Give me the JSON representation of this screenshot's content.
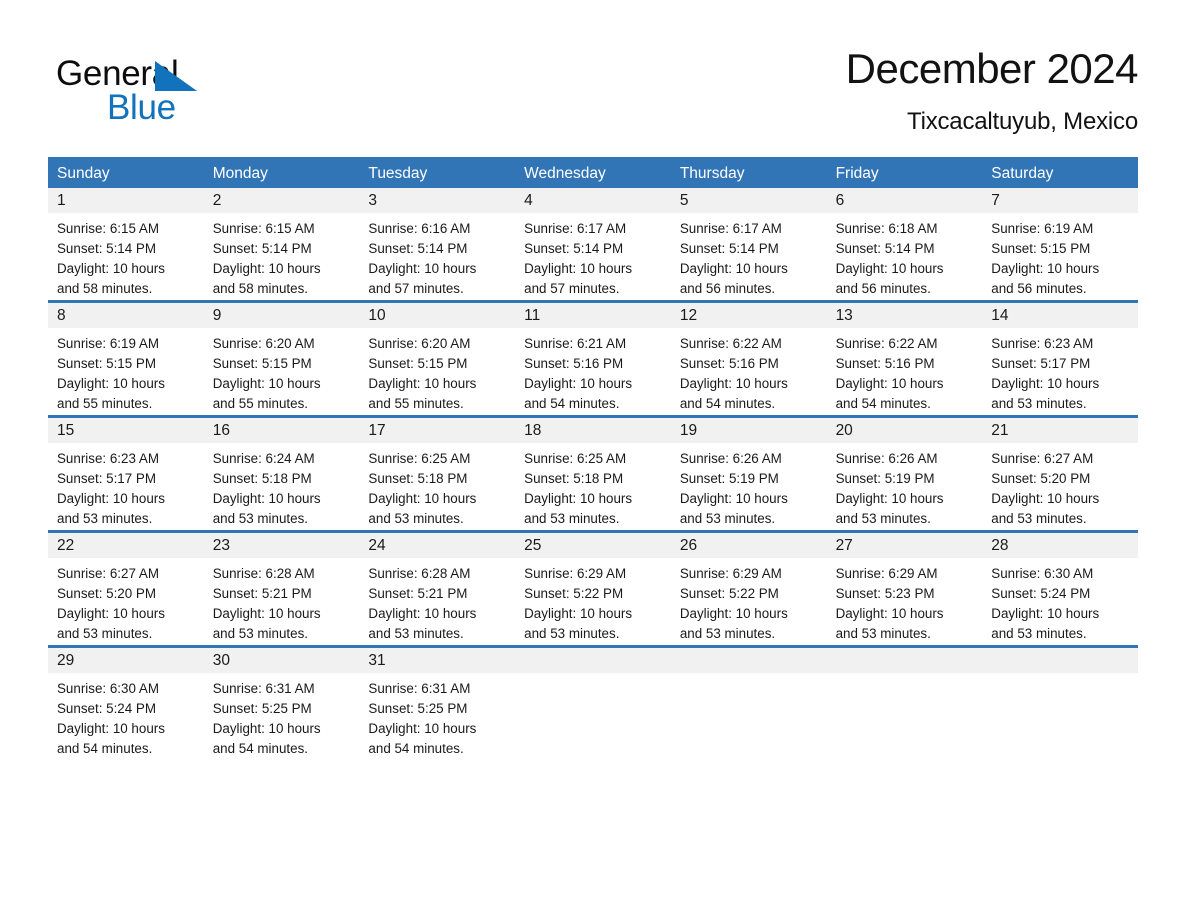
{
  "brand": {
    "name_part1": "General",
    "name_part2": "Blue",
    "triangle_color": "#1272bb",
    "text_color": "#0d0d0d"
  },
  "header": {
    "month_title": "December 2024",
    "location": "Tixcacaltuyub, Mexico"
  },
  "calendar": {
    "header_bg": "#3275b7",
    "header_text_color": "#ffffff",
    "daynum_bg": "#f1f1f1",
    "weekdays": [
      "Sunday",
      "Monday",
      "Tuesday",
      "Wednesday",
      "Thursday",
      "Friday",
      "Saturday"
    ],
    "weeks": [
      [
        {
          "day": "1",
          "sunrise": "Sunrise: 6:15 AM",
          "sunset": "Sunset: 5:14 PM",
          "daylight_line1": "Daylight: 10 hours",
          "daylight_line2": "and 58 minutes."
        },
        {
          "day": "2",
          "sunrise": "Sunrise: 6:15 AM",
          "sunset": "Sunset: 5:14 PM",
          "daylight_line1": "Daylight: 10 hours",
          "daylight_line2": "and 58 minutes."
        },
        {
          "day": "3",
          "sunrise": "Sunrise: 6:16 AM",
          "sunset": "Sunset: 5:14 PM",
          "daylight_line1": "Daylight: 10 hours",
          "daylight_line2": "and 57 minutes."
        },
        {
          "day": "4",
          "sunrise": "Sunrise: 6:17 AM",
          "sunset": "Sunset: 5:14 PM",
          "daylight_line1": "Daylight: 10 hours",
          "daylight_line2": "and 57 minutes."
        },
        {
          "day": "5",
          "sunrise": "Sunrise: 6:17 AM",
          "sunset": "Sunset: 5:14 PM",
          "daylight_line1": "Daylight: 10 hours",
          "daylight_line2": "and 56 minutes."
        },
        {
          "day": "6",
          "sunrise": "Sunrise: 6:18 AM",
          "sunset": "Sunset: 5:14 PM",
          "daylight_line1": "Daylight: 10 hours",
          "daylight_line2": "and 56 minutes."
        },
        {
          "day": "7",
          "sunrise": "Sunrise: 6:19 AM",
          "sunset": "Sunset: 5:15 PM",
          "daylight_line1": "Daylight: 10 hours",
          "daylight_line2": "and 56 minutes."
        }
      ],
      [
        {
          "day": "8",
          "sunrise": "Sunrise: 6:19 AM",
          "sunset": "Sunset: 5:15 PM",
          "daylight_line1": "Daylight: 10 hours",
          "daylight_line2": "and 55 minutes."
        },
        {
          "day": "9",
          "sunrise": "Sunrise: 6:20 AM",
          "sunset": "Sunset: 5:15 PM",
          "daylight_line1": "Daylight: 10 hours",
          "daylight_line2": "and 55 minutes."
        },
        {
          "day": "10",
          "sunrise": "Sunrise: 6:20 AM",
          "sunset": "Sunset: 5:15 PM",
          "daylight_line1": "Daylight: 10 hours",
          "daylight_line2": "and 55 minutes."
        },
        {
          "day": "11",
          "sunrise": "Sunrise: 6:21 AM",
          "sunset": "Sunset: 5:16 PM",
          "daylight_line1": "Daylight: 10 hours",
          "daylight_line2": "and 54 minutes."
        },
        {
          "day": "12",
          "sunrise": "Sunrise: 6:22 AM",
          "sunset": "Sunset: 5:16 PM",
          "daylight_line1": "Daylight: 10 hours",
          "daylight_line2": "and 54 minutes."
        },
        {
          "day": "13",
          "sunrise": "Sunrise: 6:22 AM",
          "sunset": "Sunset: 5:16 PM",
          "daylight_line1": "Daylight: 10 hours",
          "daylight_line2": "and 54 minutes."
        },
        {
          "day": "14",
          "sunrise": "Sunrise: 6:23 AM",
          "sunset": "Sunset: 5:17 PM",
          "daylight_line1": "Daylight: 10 hours",
          "daylight_line2": "and 53 minutes."
        }
      ],
      [
        {
          "day": "15",
          "sunrise": "Sunrise: 6:23 AM",
          "sunset": "Sunset: 5:17 PM",
          "daylight_line1": "Daylight: 10 hours",
          "daylight_line2": "and 53 minutes."
        },
        {
          "day": "16",
          "sunrise": "Sunrise: 6:24 AM",
          "sunset": "Sunset: 5:18 PM",
          "daylight_line1": "Daylight: 10 hours",
          "daylight_line2": "and 53 minutes."
        },
        {
          "day": "17",
          "sunrise": "Sunrise: 6:25 AM",
          "sunset": "Sunset: 5:18 PM",
          "daylight_line1": "Daylight: 10 hours",
          "daylight_line2": "and 53 minutes."
        },
        {
          "day": "18",
          "sunrise": "Sunrise: 6:25 AM",
          "sunset": "Sunset: 5:18 PM",
          "daylight_line1": "Daylight: 10 hours",
          "daylight_line2": "and 53 minutes."
        },
        {
          "day": "19",
          "sunrise": "Sunrise: 6:26 AM",
          "sunset": "Sunset: 5:19 PM",
          "daylight_line1": "Daylight: 10 hours",
          "daylight_line2": "and 53 minutes."
        },
        {
          "day": "20",
          "sunrise": "Sunrise: 6:26 AM",
          "sunset": "Sunset: 5:19 PM",
          "daylight_line1": "Daylight: 10 hours",
          "daylight_line2": "and 53 minutes."
        },
        {
          "day": "21",
          "sunrise": "Sunrise: 6:27 AM",
          "sunset": "Sunset: 5:20 PM",
          "daylight_line1": "Daylight: 10 hours",
          "daylight_line2": "and 53 minutes."
        }
      ],
      [
        {
          "day": "22",
          "sunrise": "Sunrise: 6:27 AM",
          "sunset": "Sunset: 5:20 PM",
          "daylight_line1": "Daylight: 10 hours",
          "daylight_line2": "and 53 minutes."
        },
        {
          "day": "23",
          "sunrise": "Sunrise: 6:28 AM",
          "sunset": "Sunset: 5:21 PM",
          "daylight_line1": "Daylight: 10 hours",
          "daylight_line2": "and 53 minutes."
        },
        {
          "day": "24",
          "sunrise": "Sunrise: 6:28 AM",
          "sunset": "Sunset: 5:21 PM",
          "daylight_line1": "Daylight: 10 hours",
          "daylight_line2": "and 53 minutes."
        },
        {
          "day": "25",
          "sunrise": "Sunrise: 6:29 AM",
          "sunset": "Sunset: 5:22 PM",
          "daylight_line1": "Daylight: 10 hours",
          "daylight_line2": "and 53 minutes."
        },
        {
          "day": "26",
          "sunrise": "Sunrise: 6:29 AM",
          "sunset": "Sunset: 5:22 PM",
          "daylight_line1": "Daylight: 10 hours",
          "daylight_line2": "and 53 minutes."
        },
        {
          "day": "27",
          "sunrise": "Sunrise: 6:29 AM",
          "sunset": "Sunset: 5:23 PM",
          "daylight_line1": "Daylight: 10 hours",
          "daylight_line2": "and 53 minutes."
        },
        {
          "day": "28",
          "sunrise": "Sunrise: 6:30 AM",
          "sunset": "Sunset: 5:24 PM",
          "daylight_line1": "Daylight: 10 hours",
          "daylight_line2": "and 53 minutes."
        }
      ],
      [
        {
          "day": "29",
          "sunrise": "Sunrise: 6:30 AM",
          "sunset": "Sunset: 5:24 PM",
          "daylight_line1": "Daylight: 10 hours",
          "daylight_line2": "and 54 minutes."
        },
        {
          "day": "30",
          "sunrise": "Sunrise: 6:31 AM",
          "sunset": "Sunset: 5:25 PM",
          "daylight_line1": "Daylight: 10 hours",
          "daylight_line2": "and 54 minutes."
        },
        {
          "day": "31",
          "sunrise": "Sunrise: 6:31 AM",
          "sunset": "Sunset: 5:25 PM",
          "daylight_line1": "Daylight: 10 hours",
          "daylight_line2": "and 54 minutes."
        },
        {
          "day": "",
          "sunrise": "",
          "sunset": "",
          "daylight_line1": "",
          "daylight_line2": ""
        },
        {
          "day": "",
          "sunrise": "",
          "sunset": "",
          "daylight_line1": "",
          "daylight_line2": ""
        },
        {
          "day": "",
          "sunrise": "",
          "sunset": "",
          "daylight_line1": "",
          "daylight_line2": ""
        },
        {
          "day": "",
          "sunrise": "",
          "sunset": "",
          "daylight_line1": "",
          "daylight_line2": ""
        }
      ]
    ]
  }
}
